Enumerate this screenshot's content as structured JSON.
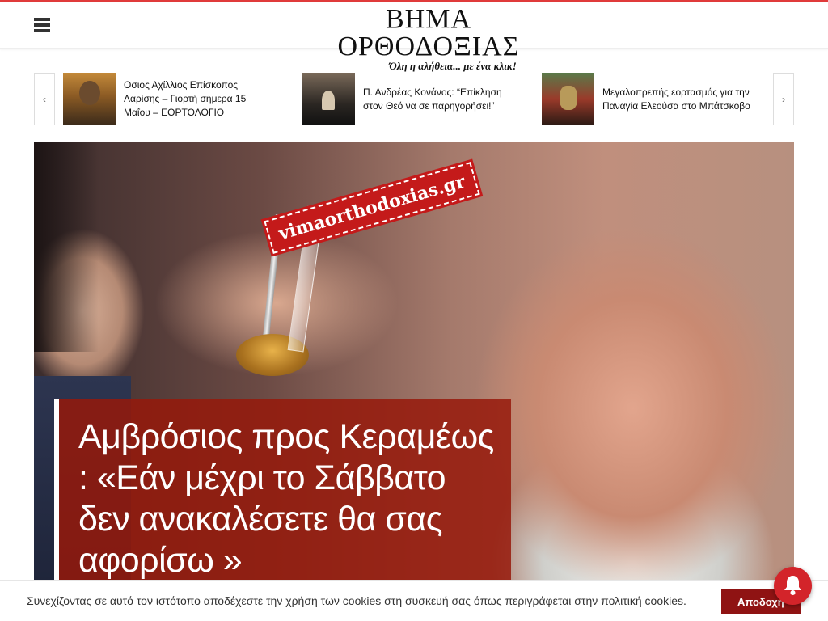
{
  "header": {
    "logo_title": "ΒΗΜΑ ΟΡΘΟΔΟΞΙΑΣ",
    "logo_subtitle": "Όλη η αλήθεια... με ένα κλικ!",
    "menu_icon": "hamburger-menu-icon",
    "accent_color": "#e03b3b"
  },
  "carousel": {
    "prev_icon": "‹",
    "next_icon": "›",
    "items": [
      {
        "title": "Οσιος Αχίλλιος Επίσκοπος Λαρίσης – Γιορτή σήμερα 15 Μαΐου – ΕΟΡΤΟΛΟΓΙΟ"
      },
      {
        "title": "Π. Ανδρέας Κονάνος: “Επίκληση στον Θεό να σε παρηγορήσει!”"
      },
      {
        "title": "Μεγαλοπρεπής εορτασμός για την Παναγία Ελεούσα στο Μπάτσκοβο"
      }
    ]
  },
  "hero": {
    "watermark": "vimaorthodoxias.gr",
    "headline": "Αμβρόσιος προς Κεραμέως : «Εάν μέχρι το Σάββατο δεν ανακαλέσετε θα σας αφορίσω »",
    "headline_bg_color": "#96190a"
  },
  "cookie_bar": {
    "text": "Συνεχίζοντας σε αυτό τον ιστότοπο αποδέχεστε την χρήση των cookies στη συσκευή σας όπως περιγράφεται στην πολιτική cookies.",
    "accept_label": "Αποδοχή",
    "button_color": "#8f1313"
  },
  "notification": {
    "icon": "bell-icon",
    "color": "#d3242a"
  }
}
